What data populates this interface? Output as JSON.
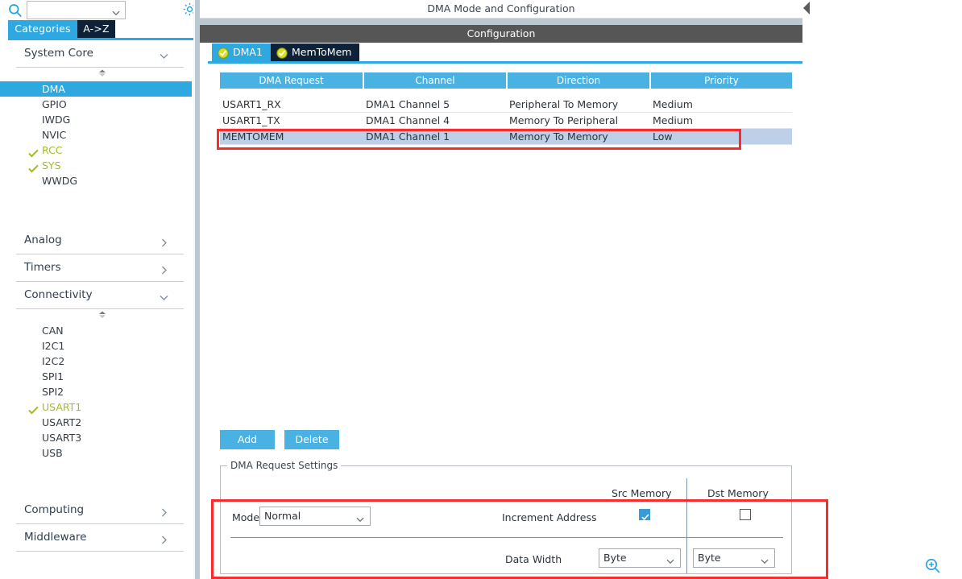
{
  "sidebar": {
    "search": {
      "value": "",
      "placeholder": "",
      "icon": "search-icon"
    },
    "gear_icon": "gear-icon",
    "tabs": [
      {
        "label": "Categories",
        "active": true
      },
      {
        "label": "A->Z",
        "active": false
      }
    ],
    "groups": [
      {
        "title": "System Core",
        "expanded": true,
        "items": [
          {
            "label": "DMA",
            "selected": true,
            "configured": false
          },
          {
            "label": "GPIO",
            "selected": false,
            "configured": false
          },
          {
            "label": "IWDG",
            "selected": false,
            "configured": false
          },
          {
            "label": "NVIC",
            "selected": false,
            "configured": false
          },
          {
            "label": "RCC",
            "selected": false,
            "configured": true
          },
          {
            "label": "SYS",
            "selected": false,
            "configured": true
          },
          {
            "label": "WWDG",
            "selected": false,
            "configured": false
          }
        ]
      },
      {
        "title": "Analog",
        "expanded": false,
        "items": []
      },
      {
        "title": "Timers",
        "expanded": false,
        "items": []
      },
      {
        "title": "Connectivity",
        "expanded": true,
        "items": [
          {
            "label": "CAN",
            "selected": false,
            "configured": false
          },
          {
            "label": "I2C1",
            "selected": false,
            "configured": false
          },
          {
            "label": "I2C2",
            "selected": false,
            "configured": false
          },
          {
            "label": "SPI1",
            "selected": false,
            "configured": false
          },
          {
            "label": "SPI2",
            "selected": false,
            "configured": false
          },
          {
            "label": "USART1",
            "selected": false,
            "configured": true
          },
          {
            "label": "USART2",
            "selected": false,
            "configured": false
          },
          {
            "label": "USART3",
            "selected": false,
            "configured": false
          },
          {
            "label": "USB",
            "selected": false,
            "configured": false
          }
        ]
      },
      {
        "title": "Computing",
        "expanded": false,
        "items": []
      },
      {
        "title": "Middleware",
        "expanded": false,
        "items": []
      }
    ]
  },
  "main": {
    "mode_header": "DMA Mode and Configuration",
    "configuration_bar": "Configuration",
    "collapse_icon": "collapse-left-arrow-icon",
    "dma_tabs": [
      {
        "label": "DMA1",
        "selected": false,
        "status_icon": "check-circle-icon"
      },
      {
        "label": "MemToMem",
        "selected": true,
        "status_icon": "check-circle-icon"
      }
    ],
    "table": {
      "columns": [
        "DMA Request",
        "Channel",
        "Direction",
        "Priority"
      ],
      "rows": [
        {
          "dma_request": "USART1_RX",
          "channel": "DMA1 Channel 5",
          "direction": "Peripheral To Memory",
          "priority": "Medium",
          "selected": false
        },
        {
          "dma_request": "USART1_TX",
          "channel": "DMA1 Channel 4",
          "direction": "Memory To Peripheral",
          "priority": "Medium",
          "selected": false
        },
        {
          "dma_request": "MEMTOMEM",
          "channel": "DMA1 Channel 1",
          "direction": "Memory To Memory",
          "priority": "Low",
          "selected": true
        }
      ]
    },
    "buttons": {
      "add": "Add",
      "delete": "Delete"
    },
    "settings": {
      "legend": "DMA Request Settings",
      "col_src": "Src Memory",
      "col_dst": "Dst Memory",
      "mode_label": "Mode",
      "mode_value": "Normal",
      "increment_address_label": "Increment Address",
      "increment_src_checked": true,
      "increment_dst_checked": false,
      "data_width_label": "Data Width",
      "data_width_src": "Byte",
      "data_width_dst": "Byte"
    }
  },
  "overlay": {
    "highlight_color": "#fb2b2b",
    "zoom_icon": "zoom-in-icon"
  },
  "colors": {
    "accent_blue": "#2ea8e0",
    "table_header_blue": "#49b2e3",
    "selected_row": "#bdd0e7",
    "tab_dark": "#0d2139",
    "config_bar_gray": "#565656",
    "configured_green": "#9fbf1f",
    "highlight_red": "#fb2b2b"
  }
}
